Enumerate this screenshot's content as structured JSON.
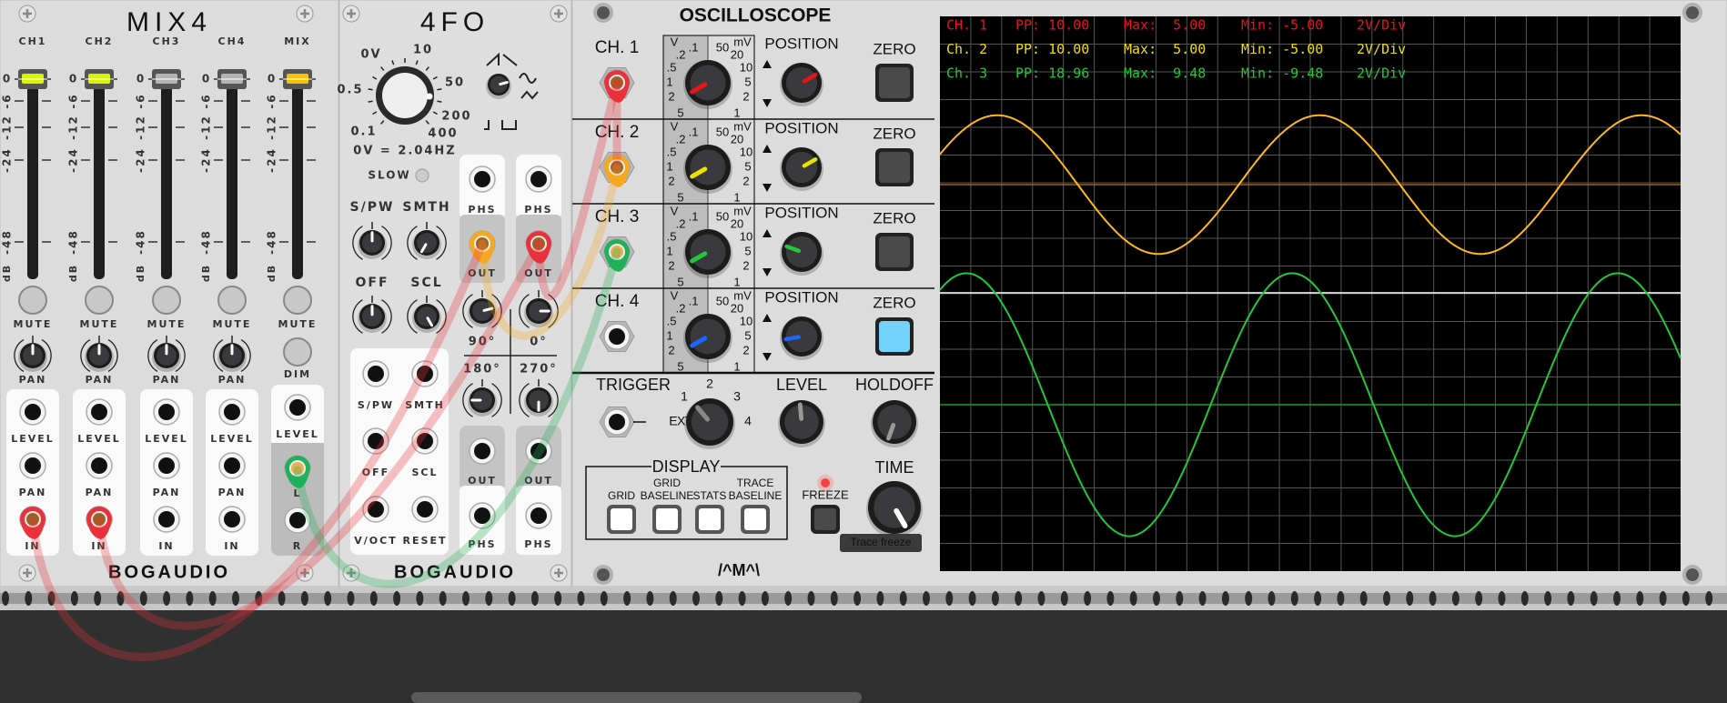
{
  "mix4": {
    "title": "MIX4",
    "channels": [
      {
        "label": "CH1",
        "fader_db": 0,
        "fader_color": "#d8f400",
        "input_cable": "#e8323c"
      },
      {
        "label": "CH2",
        "fader_db": 0,
        "fader_color": "#d8f400",
        "input_cable": "#e8323c"
      },
      {
        "label": "CH3",
        "fader_db": 0,
        "fader_color": "#b4b4b4",
        "input_cable": null
      },
      {
        "label": "CH4",
        "fader_db": 0,
        "fader_color": "#b4b4b4",
        "input_cable": null
      }
    ],
    "mix": {
      "label": "MIX",
      "fader_db": 0,
      "fader_color": "#f5c400"
    },
    "db_scale": [
      "0",
      "-6",
      "-12",
      "-24",
      "-48"
    ],
    "db_unit": "dB",
    "mute_label": "MUTE",
    "pan_label": "PAN",
    "dim_label": "DIM",
    "level_label": "LEVEL",
    "in_label": "IN",
    "l_label": "L",
    "r_label": "R",
    "brand": "BOGAUDIO"
  },
  "fourfo": {
    "title": "4FO",
    "freq_scale": [
      "0V",
      "10",
      "50",
      "200",
      "400",
      "0.1",
      "0.5"
    ],
    "freq_readout": "0V = 2.04HZ",
    "slow_label": "SLOW",
    "knob_labels": [
      "S/PW",
      "SMTH",
      "OFF",
      "SCL"
    ],
    "phs_label": "PHS",
    "out_label": "OUT",
    "phases": [
      "90°",
      "0°",
      "180°",
      "270°"
    ],
    "inputs": [
      "S/PW",
      "SMTH",
      "OFF",
      "SCL",
      "V/OCT",
      "RESET"
    ],
    "brand": "BOGAUDIO"
  },
  "scope": {
    "title": "OSCILLOSCOPE",
    "channels": [
      {
        "label": "CH. 1",
        "color": "#e8141c",
        "zero_active": false
      },
      {
        "label": "CH. 2",
        "color": "#f0e000",
        "zero_active": false
      },
      {
        "label": "CH. 3",
        "color": "#22c838",
        "zero_active": false
      },
      {
        "label": "CH. 4",
        "color": "#1e64ff",
        "zero_active": true
      }
    ],
    "volt_unit": "V",
    "millivolt_unit": "mV",
    "scale_left": [
      ".1",
      ".2",
      ".5",
      "1",
      "2",
      "5"
    ],
    "scale_right": [
      "50",
      "20",
      "10",
      "5",
      "2",
      "1"
    ],
    "position_label": "POSITION",
    "zero_label": "ZERO",
    "trigger": {
      "label": "TRIGGER",
      "ext_label": "EXT.",
      "scale": [
        "1",
        "2",
        "3",
        "4"
      ]
    },
    "level_label": "LEVEL",
    "holdoff_label": "HOLDOFF",
    "display": {
      "title": "DISPLAY",
      "buttons": [
        {
          "line1": "",
          "line2": "GRID"
        },
        {
          "line1": "GRID",
          "line2": "BASELINE"
        },
        {
          "line1": "",
          "line2": "STATS"
        },
        {
          "line1": "TRACE",
          "line2": "BASELINE"
        }
      ]
    },
    "freeze_label": "FREEZE",
    "time_label": "TIME",
    "tooltip": "Trace freeze",
    "logo": "/^M^\\",
    "stats": [
      {
        "ch": "CH. 1",
        "pp": "PP: 10.00",
        "max": "Max:  5.00",
        "min": "Min: -5.00",
        "scale": "2V/Div",
        "color": "#e8141c"
      },
      {
        "ch": "Ch. 2",
        "pp": "PP: 10.00",
        "max": "Max:  5.00",
        "min": "Min: -5.00",
        "scale": "2V/Div",
        "color": "#f0e000"
      },
      {
        "ch": "Ch. 3",
        "pp": "PP: 18.96",
        "max": "Max:  9.48",
        "min": "Min: -9.48",
        "scale": "2V/Div",
        "color": "#22c838"
      }
    ],
    "traces": [
      {
        "channel": "Ch. 2",
        "color": "#ffb91e",
        "peak_to_peak_v": 10.0,
        "volts_per_div": 2
      },
      {
        "channel": "Ch. 3",
        "color": "#22c838",
        "peak_to_peak_v": 18.96,
        "volts_per_div": 2
      }
    ]
  }
}
